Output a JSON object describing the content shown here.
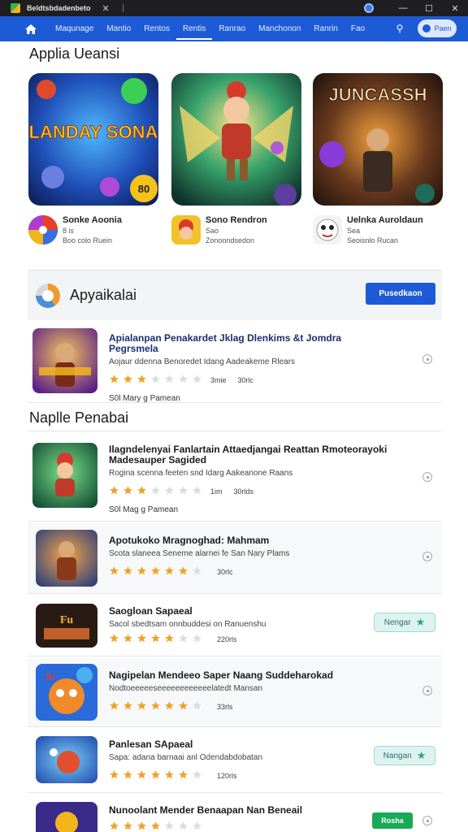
{
  "window": {
    "title": "Beldtsbdadenbeto",
    "close_glyph": "✕",
    "controls": [
      "—",
      "☐",
      "✕"
    ]
  },
  "nav": {
    "items": [
      "Maqunage",
      "Mantio",
      "Rentos",
      "Rentis",
      "Ranrao",
      "Manchonon",
      "Ranrin",
      "Fao"
    ],
    "active_index": 3,
    "account_label": "Paen"
  },
  "featured": {
    "title": "Applia Ueansi",
    "items": [
      {
        "art_text": "PLANDAY SONAS",
        "badge": "80",
        "name": "Sonke Aoonia",
        "sub1": "8 is",
        "sub2": "Boo colo Ruein"
      },
      {
        "art_text": "",
        "name": "Sono Rendron",
        "sub1": "Sao",
        "sub2": "Zonoondsedon"
      },
      {
        "art_text": "JUNCASSH",
        "name": "Uelnka Auroldaun",
        "sub1": "Sea",
        "sub2": "Seoisnlo Rucan"
      }
    ]
  },
  "promo": {
    "title": "Apyaikalai",
    "button": "Pusedkaon"
  },
  "highlight": {
    "title": "Apialanpan Penakardet Jklag Dlenkims &t Jomdra Pegrsmela",
    "desc": "Aojaur ddenna Benoredet Idang Aadeakeme Rlears",
    "rating_label": "3mie",
    "count": "30rlc",
    "developer": "S0l Mary g Pamean",
    "stars": 3
  },
  "list": {
    "title": "Naplle Penabai",
    "items": [
      {
        "title": "Ilagndelenyai Fanlartain Attaedjangai Reattan Rmoteorayoki Madesauper Sagided",
        "desc": "Rogina scenna feeten snd Idarg Aakeanone Raans",
        "rating_label": "1im",
        "count": "30rlds",
        "developer": "S0l Mag g Pamean",
        "stars": 3,
        "action": "icon"
      },
      {
        "title": "Apotukoko Mragnoghad: Mahmam",
        "desc": "Scota slaneea Seneme alarnei fe San Nary Plams",
        "rating_label": "",
        "count": "30rlc",
        "stars": 6,
        "action": "icon"
      },
      {
        "title": "Saogloan Sapaeal",
        "desc": "Sacol sbedtsam onnbuddesi on Ranuenshu",
        "rating_label": "",
        "count": "220rls",
        "stars": 5,
        "action": "pill",
        "action_label": "Nengar"
      },
      {
        "title": "Nagipelan Mendeeo Saper Naang Suddeharokad",
        "desc": "Nodtoeeeeeseeeeeeeeeeeelatedt Mansan",
        "rating_label": "",
        "count": "33rls",
        "stars": 6,
        "action": "icon"
      },
      {
        "title": "Panlesan SApaeal",
        "desc": "Sapa: adana barnaai anl Odendabdobatan",
        "rating_label": "",
        "count": "120rls",
        "stars": 6,
        "action": "pill",
        "action_label": "Nangan"
      },
      {
        "title": "Nunoolant Mender Benaapan Nan Beneail",
        "desc": "",
        "rating_label": "",
        "count": "",
        "stars": 4,
        "action": "install",
        "action_label": "Rosha"
      }
    ]
  },
  "colors": {
    "nav": "#1d5bd6",
    "titlebar": "#1f1f22",
    "star": "#f0a32a",
    "install": "#1aa957"
  }
}
